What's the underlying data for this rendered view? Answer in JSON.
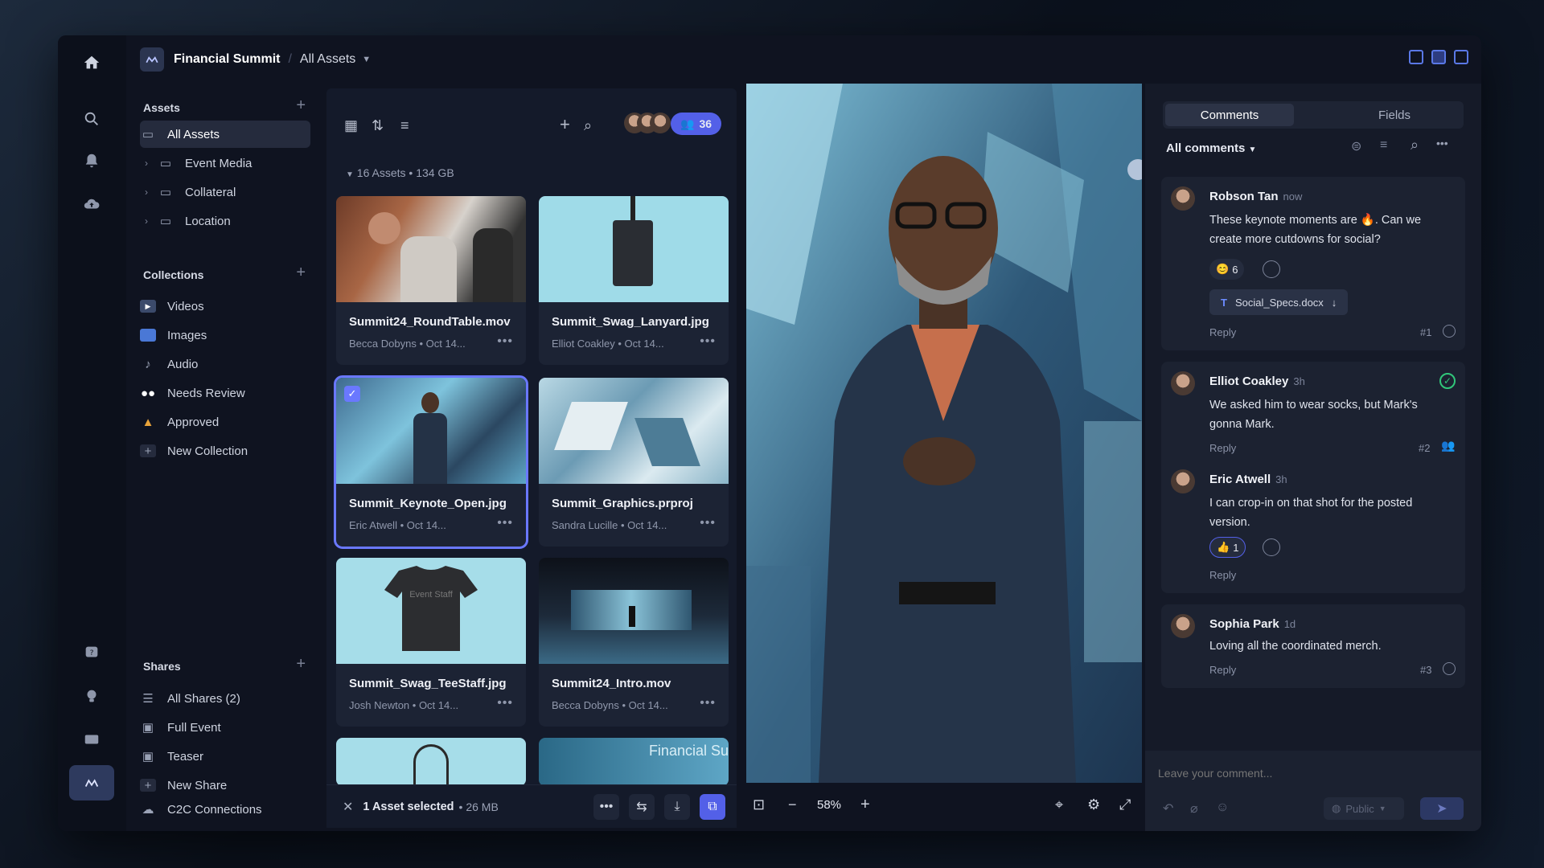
{
  "topbar": {
    "project": "Financial Summit",
    "view": "All Assets"
  },
  "sidebar": {
    "assets_title": "Assets",
    "assets": [
      {
        "label": "All Assets",
        "active": true
      },
      {
        "label": "Event Media"
      },
      {
        "label": "Collateral"
      },
      {
        "label": "Location"
      }
    ],
    "collections_title": "Collections",
    "collections": [
      {
        "label": "Videos"
      },
      {
        "label": "Images"
      },
      {
        "label": "Audio"
      },
      {
        "label": "Needs Review"
      },
      {
        "label": "Approved"
      },
      {
        "label": "New Collection"
      }
    ],
    "shares_title": "Shares",
    "shares": [
      {
        "label": "All Shares (2)"
      },
      {
        "label": "Full Event"
      },
      {
        "label": "Teaser"
      },
      {
        "label": "New Share"
      }
    ],
    "c2c": "C2C Connections"
  },
  "grid": {
    "user_count": "36",
    "summary": "16 Assets",
    "size": "134 GB",
    "cards": [
      {
        "name": "Summit24_RoundTable.mov",
        "author": "Becca Dobyns",
        "date": "Oct 14..."
      },
      {
        "name": "Summit_Swag_Lanyard.jpg",
        "author": "Elliot Coakley",
        "date": "Oct 14..."
      },
      {
        "name": "Summit_Keynote_Open.jpg",
        "author": "Eric Atwell",
        "date": "Oct 14..."
      },
      {
        "name": "Summit_Graphics.prproj",
        "author": "Sandra Lucille",
        "date": "Oct 14..."
      },
      {
        "name": "Summit_Swag_TeeStaff.jpg",
        "author": "Josh Newton",
        "date": "Oct 14..."
      },
      {
        "name": "Summit24_Intro.mov",
        "author": "Becca Dobyns",
        "date": "Oct 14..."
      }
    ],
    "tee_text": "Event Staff",
    "partial_text": "Financial Su",
    "selection": "1 Asset selected",
    "selection_size": "26 MB"
  },
  "viewer": {
    "zoom": "58%"
  },
  "comments": {
    "tab_comments": "Comments",
    "tab_fields": "Fields",
    "filter": "All comments",
    "items": [
      {
        "name": "Robson Tan",
        "time": "now",
        "text": "These keynote moments are 🔥. Can we create more cutdowns for social?",
        "reaction": "6",
        "attachment": "Social_Specs.docx",
        "reply": "Reply",
        "num": "#1"
      },
      {
        "name": "Elliot Coakley",
        "time": "3h",
        "text": "We asked him to wear socks, but Mark's gonna Mark.",
        "reply": "Reply",
        "num": "#2"
      },
      {
        "name": "Eric Atwell",
        "time": "3h",
        "text": "I can crop-in on that shot for the posted version.",
        "reaction": "1",
        "reply": "Reply"
      },
      {
        "name": "Sophia Park",
        "time": "1d",
        "text": "Loving all the coordinated merch.",
        "reply": "Reply",
        "num": "#3"
      }
    ],
    "placeholder": "Leave your comment...",
    "visibility": "Public"
  }
}
